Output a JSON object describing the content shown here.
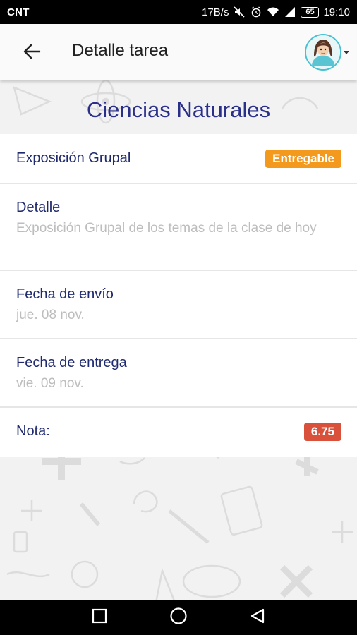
{
  "status_bar": {
    "carrier": "CNT",
    "net_speed": "17B/s",
    "battery": "65",
    "time": "19:10",
    "icons": [
      "mute-icon",
      "alarm-icon",
      "wifi-icon",
      "signal-icon",
      "battery-icon"
    ]
  },
  "app_bar": {
    "title": "Detalle tarea",
    "back_icon": "arrow-left-icon",
    "avatar": "user-avatar"
  },
  "subject": {
    "name": "Ciencias Naturales"
  },
  "task": {
    "title": "Exposición Grupal",
    "type_badge": "Entregable",
    "detail_label": "Detalle",
    "detail_text": "Exposición Grupal de los temas de la clase de hoy",
    "sent_label": "Fecha de envío",
    "sent_date": "jue. 08 nov.",
    "due_label": "Fecha de entrega",
    "due_date": "vie. 09 nov.",
    "grade_label": "Nota:",
    "grade_value": "6.75"
  },
  "colors": {
    "label": "#1f2a6e",
    "subject": "#2a2f8a",
    "muted": "#bdbdbd",
    "badge_orange": "#f39a1e",
    "badge_red": "#d9513b"
  },
  "nav_bar": {
    "icons": [
      "recent-apps-icon",
      "home-icon",
      "back-icon"
    ]
  }
}
